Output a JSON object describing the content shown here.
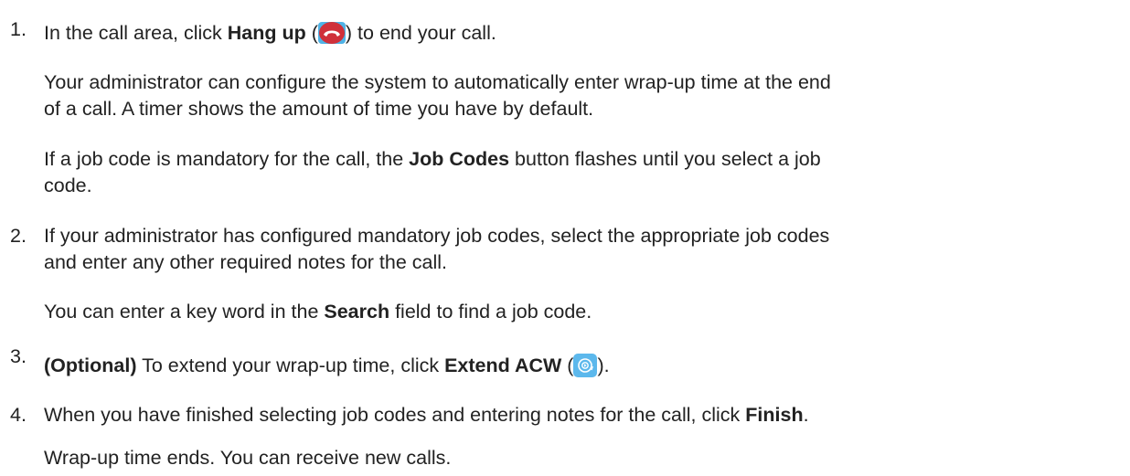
{
  "steps": [
    {
      "number": "1.",
      "line1": {
        "pre": "In the call area, click ",
        "bold": "Hang up",
        "mid": " (",
        "icon": "hang-up-icon",
        "post": ") to end your call."
      },
      "para2_line1": "Your administrator can configure the system to automatically enter wrap-up time at the end",
      "para2_line2": "of a call. A timer shows the amount of time you have by default.",
      "para3_line1": {
        "pre": "If a job code is mandatory for the call, the ",
        "bold": "Job Codes",
        "post": " button flashes until you select a job"
      },
      "para3_line2": "code."
    },
    {
      "number": "2.",
      "line1": "If your administrator has configured mandatory job codes, select the appropriate job codes",
      "line2": "and enter any other required notes for the call.",
      "para2": {
        "pre": "You can enter a key word in the ",
        "bold": "Search",
        "post": " field to find a job code."
      }
    },
    {
      "number": "3.",
      "line1": {
        "bold_pre": "(Optional)",
        "pre": " To extend your wrap-up time, click ",
        "bold": "Extend ACW",
        "mid": " (",
        "icon": "extend-acw-icon",
        "post": ")."
      }
    },
    {
      "number": "4.",
      "line1": {
        "pre": "When you have finished selecting job codes and entering notes for the call, click ",
        "bold": "Finish",
        "post": "."
      },
      "para2": "Wrap-up time ends. You can receive new calls."
    }
  ],
  "colors": {
    "text": "#222222",
    "hangup_red": "#d0303a",
    "icon_blue": "#5cb8ec"
  }
}
